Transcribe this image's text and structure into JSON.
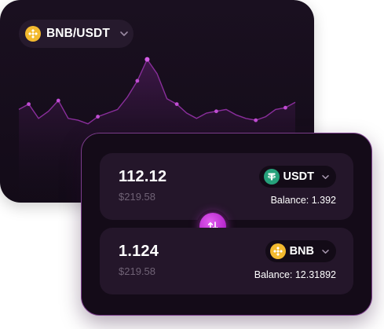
{
  "pair_selector": {
    "label": "BNB/USDT",
    "icon": "bnb-coin-icon"
  },
  "colors": {
    "accent": "#c13fd8",
    "chart_line": "#8a2e9c",
    "bnb": "#f3ba2f",
    "usdt": "#26a17b",
    "muted_text": "#6f6275"
  },
  "chart_data": {
    "type": "line",
    "values": [
      52,
      55,
      47,
      51,
      57,
      47,
      46,
      44,
      48,
      50,
      52,
      59,
      68,
      80,
      72,
      58,
      55,
      50,
      47,
      50,
      51,
      52,
      49,
      47,
      46,
      48,
      52,
      53,
      56
    ],
    "marker_indices": [
      1,
      4,
      8,
      12,
      16,
      20,
      24,
      27
    ],
    "highlight_index": 13,
    "grid": "vertical",
    "ylim": [
      0,
      100
    ]
  },
  "swap": {
    "from": {
      "amount": "112.12",
      "fiat": "$219.58",
      "token": "USDT",
      "balance": "Balance: 1.392"
    },
    "to": {
      "amount": "1.124",
      "fiat": "$219.58",
      "token": "BNB",
      "balance": "Balance: 12.31892"
    },
    "switch_icon": "swap-arrows-icon"
  }
}
